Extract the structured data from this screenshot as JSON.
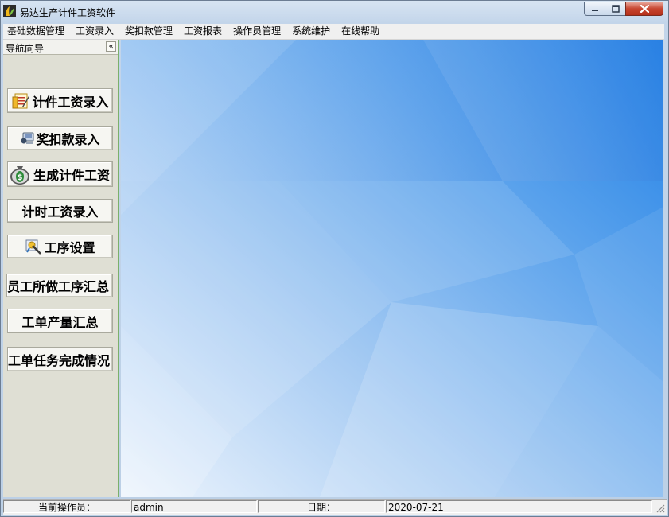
{
  "window": {
    "title": "易达生产计件工资软件",
    "app_icon": "leaf-logo-icon",
    "controls": [
      "minimize-icon",
      "maximize-icon",
      "close-icon"
    ]
  },
  "menubar": {
    "items": [
      "基础数据管理",
      "工资录入",
      "奖扣款管理",
      "工资报表",
      "操作员管理",
      "系统维护",
      "在线帮助"
    ]
  },
  "nav": {
    "title": "导航向导",
    "collapse_label": "«",
    "buttons": [
      {
        "label": "计件工资录入",
        "icon": "form-edit-icon"
      },
      {
        "label": "奖扣款录入",
        "icon": "keyboard-icon"
      },
      {
        "label": "生成计件工资",
        "icon": "money-bag-icon"
      },
      {
        "label": "计时工资录入",
        "icon": ""
      },
      {
        "label": "工序设置",
        "icon": "settings-wand-icon"
      },
      {
        "label": "员工所做工序汇总",
        "icon": ""
      },
      {
        "label": "工单产量汇总",
        "icon": ""
      },
      {
        "label": "工单任务完成情况",
        "icon": ""
      }
    ]
  },
  "statusbar": {
    "operator_label": "当前操作员：",
    "operator_value": "admin",
    "date_label": "日期：",
    "date_value": "2020-07-21"
  },
  "colors": {
    "nav_border": "#7bb06b",
    "desktop_blue": "#3b8ee8",
    "close_red": "#c7452f"
  }
}
